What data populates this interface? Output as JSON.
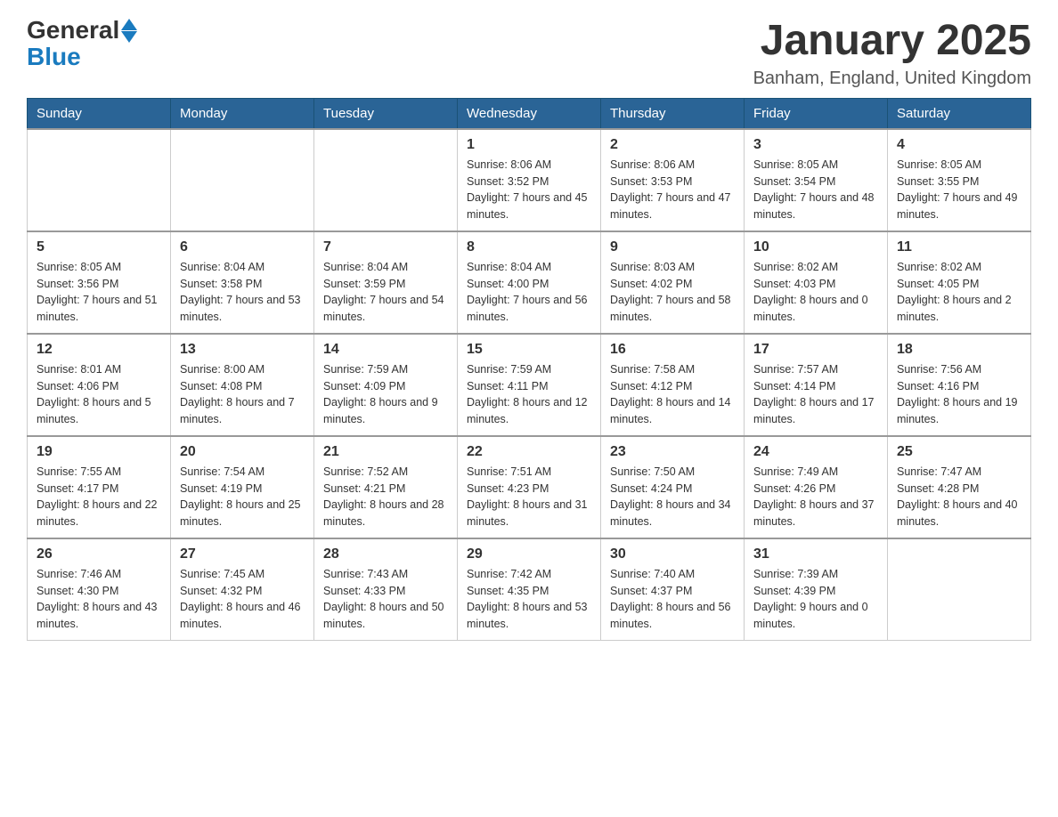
{
  "logo": {
    "general": "General",
    "blue": "Blue"
  },
  "title": "January 2025",
  "location": "Banham, England, United Kingdom",
  "weekdays": [
    "Sunday",
    "Monday",
    "Tuesday",
    "Wednesday",
    "Thursday",
    "Friday",
    "Saturday"
  ],
  "weeks": [
    [
      {
        "day": "",
        "info": ""
      },
      {
        "day": "",
        "info": ""
      },
      {
        "day": "",
        "info": ""
      },
      {
        "day": "1",
        "info": "Sunrise: 8:06 AM\nSunset: 3:52 PM\nDaylight: 7 hours and 45 minutes."
      },
      {
        "day": "2",
        "info": "Sunrise: 8:06 AM\nSunset: 3:53 PM\nDaylight: 7 hours and 47 minutes."
      },
      {
        "day": "3",
        "info": "Sunrise: 8:05 AM\nSunset: 3:54 PM\nDaylight: 7 hours and 48 minutes."
      },
      {
        "day": "4",
        "info": "Sunrise: 8:05 AM\nSunset: 3:55 PM\nDaylight: 7 hours and 49 minutes."
      }
    ],
    [
      {
        "day": "5",
        "info": "Sunrise: 8:05 AM\nSunset: 3:56 PM\nDaylight: 7 hours and 51 minutes."
      },
      {
        "day": "6",
        "info": "Sunrise: 8:04 AM\nSunset: 3:58 PM\nDaylight: 7 hours and 53 minutes."
      },
      {
        "day": "7",
        "info": "Sunrise: 8:04 AM\nSunset: 3:59 PM\nDaylight: 7 hours and 54 minutes."
      },
      {
        "day": "8",
        "info": "Sunrise: 8:04 AM\nSunset: 4:00 PM\nDaylight: 7 hours and 56 minutes."
      },
      {
        "day": "9",
        "info": "Sunrise: 8:03 AM\nSunset: 4:02 PM\nDaylight: 7 hours and 58 minutes."
      },
      {
        "day": "10",
        "info": "Sunrise: 8:02 AM\nSunset: 4:03 PM\nDaylight: 8 hours and 0 minutes."
      },
      {
        "day": "11",
        "info": "Sunrise: 8:02 AM\nSunset: 4:05 PM\nDaylight: 8 hours and 2 minutes."
      }
    ],
    [
      {
        "day": "12",
        "info": "Sunrise: 8:01 AM\nSunset: 4:06 PM\nDaylight: 8 hours and 5 minutes."
      },
      {
        "day": "13",
        "info": "Sunrise: 8:00 AM\nSunset: 4:08 PM\nDaylight: 8 hours and 7 minutes."
      },
      {
        "day": "14",
        "info": "Sunrise: 7:59 AM\nSunset: 4:09 PM\nDaylight: 8 hours and 9 minutes."
      },
      {
        "day": "15",
        "info": "Sunrise: 7:59 AM\nSunset: 4:11 PM\nDaylight: 8 hours and 12 minutes."
      },
      {
        "day": "16",
        "info": "Sunrise: 7:58 AM\nSunset: 4:12 PM\nDaylight: 8 hours and 14 minutes."
      },
      {
        "day": "17",
        "info": "Sunrise: 7:57 AM\nSunset: 4:14 PM\nDaylight: 8 hours and 17 minutes."
      },
      {
        "day": "18",
        "info": "Sunrise: 7:56 AM\nSunset: 4:16 PM\nDaylight: 8 hours and 19 minutes."
      }
    ],
    [
      {
        "day": "19",
        "info": "Sunrise: 7:55 AM\nSunset: 4:17 PM\nDaylight: 8 hours and 22 minutes."
      },
      {
        "day": "20",
        "info": "Sunrise: 7:54 AM\nSunset: 4:19 PM\nDaylight: 8 hours and 25 minutes."
      },
      {
        "day": "21",
        "info": "Sunrise: 7:52 AM\nSunset: 4:21 PM\nDaylight: 8 hours and 28 minutes."
      },
      {
        "day": "22",
        "info": "Sunrise: 7:51 AM\nSunset: 4:23 PM\nDaylight: 8 hours and 31 minutes."
      },
      {
        "day": "23",
        "info": "Sunrise: 7:50 AM\nSunset: 4:24 PM\nDaylight: 8 hours and 34 minutes."
      },
      {
        "day": "24",
        "info": "Sunrise: 7:49 AM\nSunset: 4:26 PM\nDaylight: 8 hours and 37 minutes."
      },
      {
        "day": "25",
        "info": "Sunrise: 7:47 AM\nSunset: 4:28 PM\nDaylight: 8 hours and 40 minutes."
      }
    ],
    [
      {
        "day": "26",
        "info": "Sunrise: 7:46 AM\nSunset: 4:30 PM\nDaylight: 8 hours and 43 minutes."
      },
      {
        "day": "27",
        "info": "Sunrise: 7:45 AM\nSunset: 4:32 PM\nDaylight: 8 hours and 46 minutes."
      },
      {
        "day": "28",
        "info": "Sunrise: 7:43 AM\nSunset: 4:33 PM\nDaylight: 8 hours and 50 minutes."
      },
      {
        "day": "29",
        "info": "Sunrise: 7:42 AM\nSunset: 4:35 PM\nDaylight: 8 hours and 53 minutes."
      },
      {
        "day": "30",
        "info": "Sunrise: 7:40 AM\nSunset: 4:37 PM\nDaylight: 8 hours and 56 minutes."
      },
      {
        "day": "31",
        "info": "Sunrise: 7:39 AM\nSunset: 4:39 PM\nDaylight: 9 hours and 0 minutes."
      },
      {
        "day": "",
        "info": ""
      }
    ]
  ]
}
